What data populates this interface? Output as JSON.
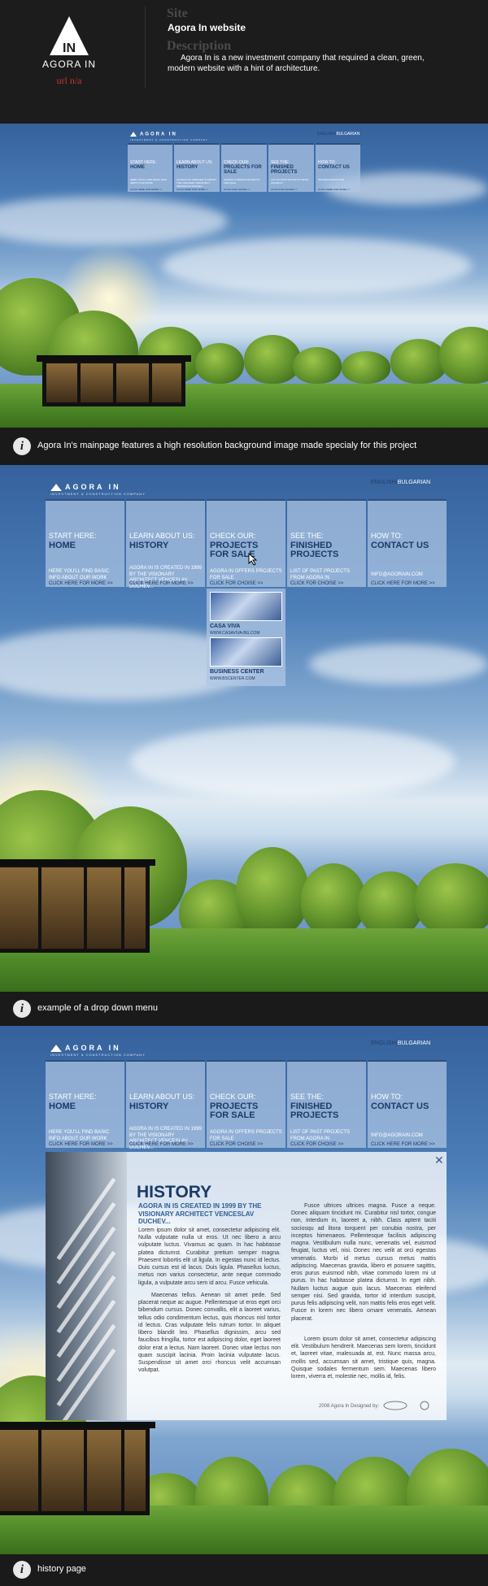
{
  "header": {
    "logo_name": "AGORA IN",
    "logo_monogram": "IN",
    "url": "url n/a",
    "site_label": "Site",
    "site_value": "Agora In website",
    "description_label": "Description",
    "description_value": "Agora In is a new investment company that required a clean, green, modern website with a hint of architecture."
  },
  "site": {
    "brand": "AGORA IN",
    "brand_sub": "INVESTMENT & CONSTRUCTION COMPANY",
    "lang_active": "ENGLISH",
    "lang_sep": "/",
    "lang_other": "BULGARIAN",
    "nav": [
      {
        "kicker": "START HERE:",
        "title": "HOME",
        "desc": "HERE YOU'LL FIND BASIC INFO ABOUT OUR WORK",
        "more": "CLICK HERE FOR MORE >>"
      },
      {
        "kicker": "LEARN ABOUT US:",
        "title": "HISTORY",
        "desc": "AGORA IN IS CREATED IN 1999 BY THE VISIONARY ARCHITECT VENCESLAV DUCHEV...",
        "more": "CLICK HERE FOR MORE >>"
      },
      {
        "kicker": "CHECK OUR:",
        "title": "PROJECTS FOR SALE",
        "desc": "AGORA IN OFFERS PROJECTS FOR SALE",
        "more": "CLICK FOR CHOISE >>"
      },
      {
        "kicker": "SEE THE:",
        "title": "FINISHED PROJECTS",
        "desc": "LIST OF PAST PROJECTS FROM AGORA IN",
        "more": "CLICK FOR CHOISE >>"
      },
      {
        "kicker": "HOW TO:",
        "title": "CONTACT US",
        "desc": "INFO@AGORAIN.COM",
        "more": "CLICK HERE FOR MORE >>"
      }
    ],
    "dropdown": [
      {
        "title": "CASA VIVA",
        "url": "WWW.CASAVIVA-BG.COM"
      },
      {
        "title": "BUSINESS CENTER",
        "url": "WWW.BSCENTER.COM"
      }
    ]
  },
  "captions": {
    "one": "Agora In's mainpage features a high resolution background image made specialy for this project",
    "two": "example of a drop down menu",
    "three": "history page"
  },
  "info_icon": "i",
  "history": {
    "close": "✕",
    "title": "HISTORY",
    "subtitle": "AGORA IN IS CREATED IN 1999 BY THE VISIONARY ARCHITECT VENCESLAV DUCHEV...",
    "p1": "Lorem ipsum dolor sit amet, consectetur adipiscing elit. Nulla vulputate nulla ut eros. Ut nec libero a arcu vulputate luctus. Vivamus ac quam. In hac habitasse platea dictumst. Curabitur pretium semper magna. Praesent lobortis elit ut ligula. In egestas nunc id lectus. Duis cursus est id lacus. Duis ligula. Phasellus luctus, metus non varius consectetur, ante neque commodo ligula, a vulputate arcu sem id arcu. Fusce vehicula.",
    "p2": "Maecenas tellus. Aenean sit amet pede. Sed placerat neque ac augue. Pellentesque ut eros eget orci bibendum cursus. Donec convallis, elit a laoreet varius, tellus odio condimentum lectus, quis rhoncus nisl tortor id lectus. Cras vulputate felis rutrum tortor. In aliquet libero blandit leo. Phasellus dignissim, arcu sed faucibus fringilla, tortor est adipiscing dolor, eget laoreet dolor erat a lectus. Nam laoreet. Donec vitae lectus non quam suscipit lacinia. Proin lacinia vulputate lacus. Suspendisse sit amet orci rhoncus velit accumsan volutpat.",
    "p3": "Fusce ultrices ultrices magna. Fusce a neque. Donec aliquam tincidunt mi. Curabitur nisl tortor, congue non, interdum in, laoreet a, nibh. Class aptent taciti sociosqu ad litora torquent per conubia nostra, per inceptos himenaeos. Pellentesque facilisis adipiscing magna. Vestibulum nulla nunc, venenatis vel, euismod feugiat, luctus vel, nisi. Donec nec velit at orci egestas venenatis. Morbi id metus cursus metus mattis adipiscing. Maecenas gravida, libero et posuere sagittis, eros purus euismod nibh, vitae commodo lorem mi ut purus. In hac habitasse platea dictumst. In eget nibh. Nullam luctus augue quis lacus. Maecenas eleifend semper nisi. Sed gravida, tortor id interdum suscipit, purus felis adipiscing velit, non mattis felis eros eget velit. Fusce in lorem nec libero ornare venenatis. Aenean placerat.",
    "p4": "Lorem ipsum dolor sit amet, consectetur adipiscing elit. Vestibulum hendrerit. Maecenas sem lorem, tincidunt et, laoreet vitae, malesuada at, est. Nunc massa arcu, mollis sed, accumsan sit amet, tristique quis, magna. Quisque sodales fermentum sem. Maecenas libero lorem, viverra et, molestie nec, mollis id, felis.",
    "footer": "2008 Agora In Designed by:"
  }
}
